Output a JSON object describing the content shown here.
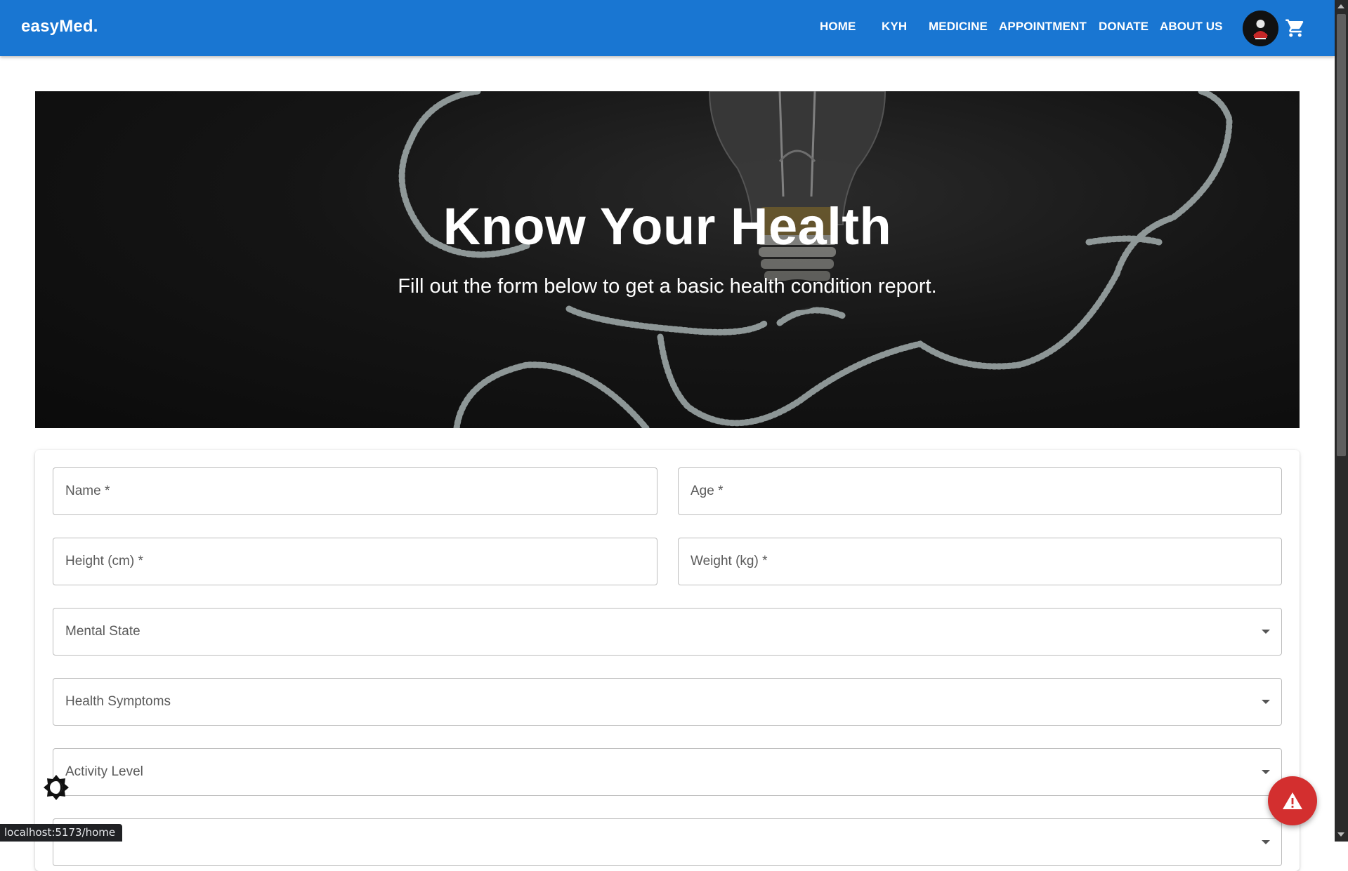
{
  "brand": "easyMed.",
  "nav": {
    "items": [
      "HOME",
      "KYH",
      "MEDICINE",
      "APPOINTMENT",
      "DONATE",
      "ABOUT US"
    ]
  },
  "icons": {
    "avatar": "user-avatar",
    "cart": "cart-icon",
    "theme_toggle": "theme-toggle-icon",
    "emergency": "warning-icon"
  },
  "hero": {
    "title": "Know Your Health",
    "subtitle": "Fill out the form below to get a basic health condition report."
  },
  "form": {
    "name_label": "Name *",
    "age_label": "Age *",
    "height_label": "Height (cm) *",
    "weight_label": "Weight (kg) *",
    "mental_state_label": "Mental State",
    "symptoms_label": "Health Symptoms",
    "activity_label": "Activity Level"
  },
  "status_bar": {
    "url": "localhost:5173/home"
  },
  "colors": {
    "appbar": "#1976d2",
    "fab": "#d32f2f",
    "hero_bg": "#111111"
  }
}
